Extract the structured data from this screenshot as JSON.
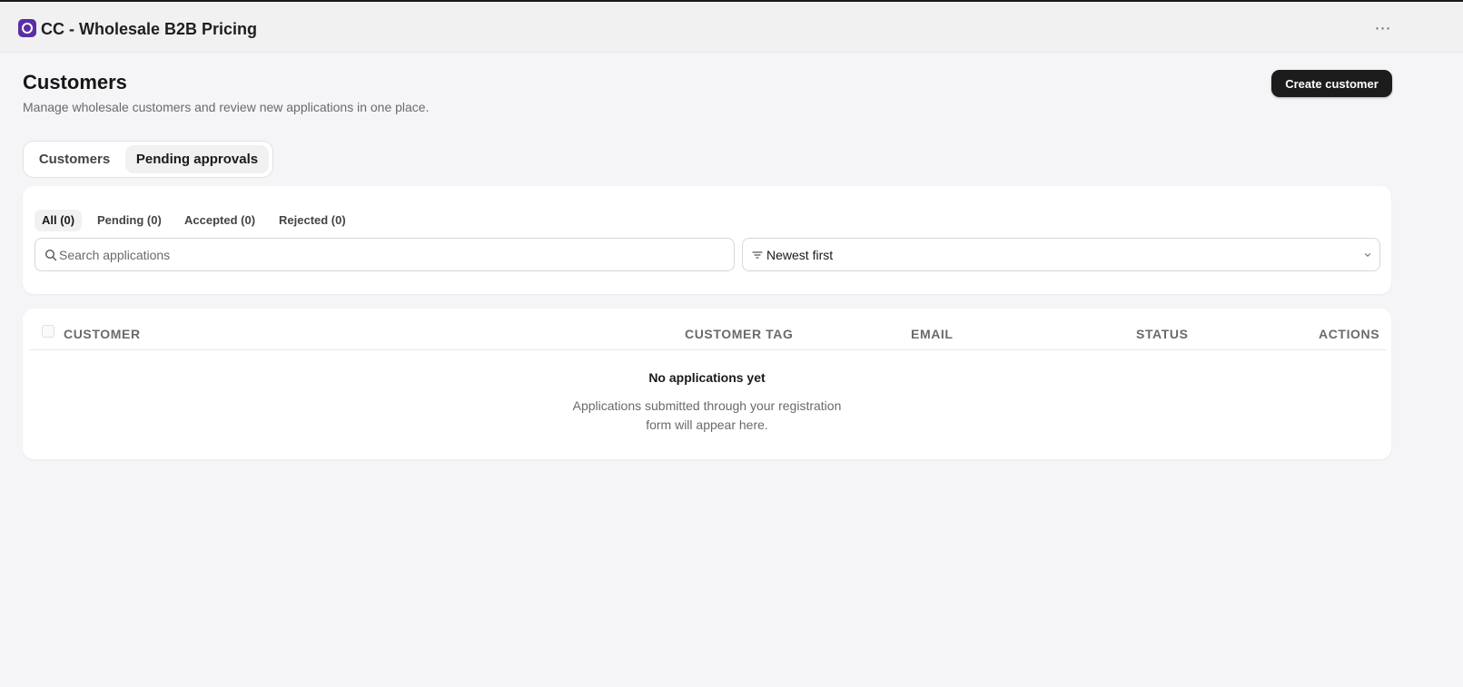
{
  "app": {
    "title": "CC - Wholesale B2B Pricing",
    "more_label": "⋯",
    "logo_icon": "app-logo-icon",
    "brand_color": "#5b2ea6"
  },
  "page": {
    "title": "Customers",
    "subtitle": "Manage wholesale customers and review new applications in one place.",
    "create_button": "Create customer"
  },
  "tabs": [
    {
      "label": "Customers",
      "active": false
    },
    {
      "label": "Pending approvals",
      "active": true
    }
  ],
  "filters": [
    {
      "label": "All (0)",
      "active": true
    },
    {
      "label": "Pending (0)",
      "active": false
    },
    {
      "label": "Accepted (0)",
      "active": false
    },
    {
      "label": "Rejected (0)",
      "active": false
    }
  ],
  "search": {
    "placeholder": "Search applications",
    "value": "",
    "icon": "search-icon"
  },
  "sort": {
    "value": "Newest first",
    "icon": "sort-icon"
  },
  "table": {
    "columns": [
      "CUSTOMER",
      "CUSTOMER TAG",
      "EMAIL",
      "STATUS",
      "ACTIONS"
    ],
    "rows": [],
    "empty_title": "No applications yet",
    "empty_description": "Applications submitted through your registration form will appear here."
  }
}
